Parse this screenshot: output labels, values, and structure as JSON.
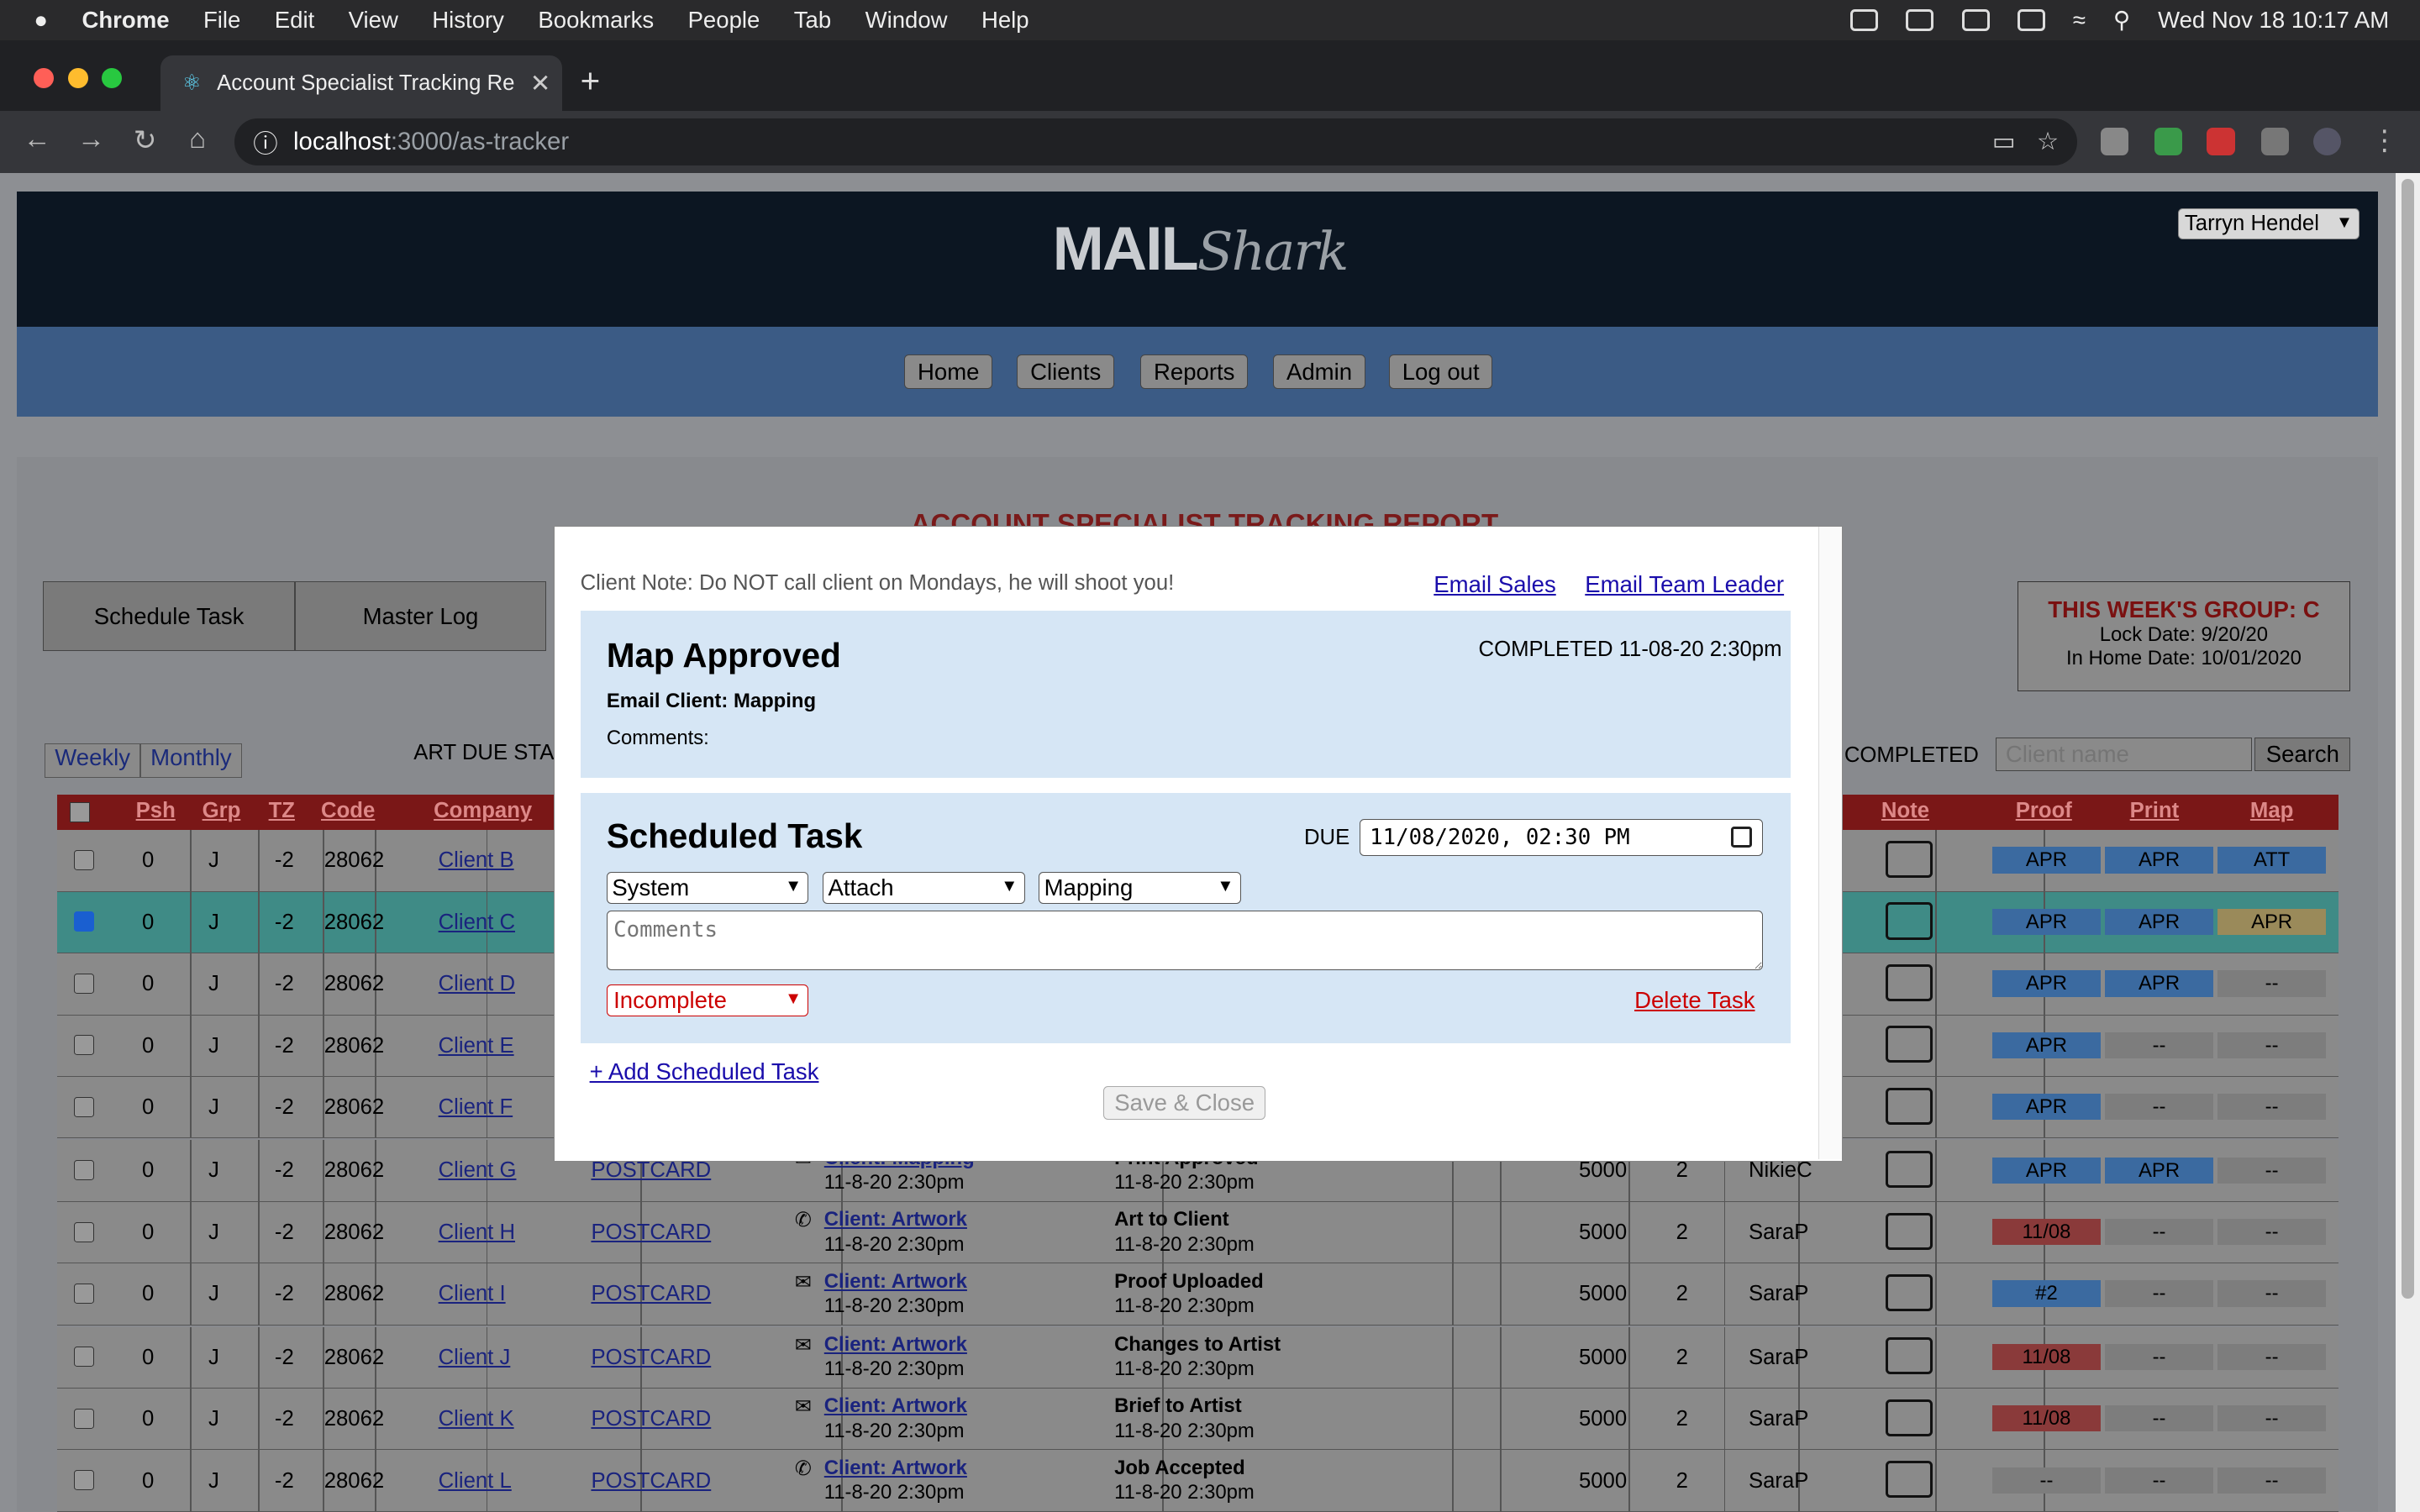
{
  "menubar": {
    "apple": "",
    "app": "Chrome",
    "items": [
      "File",
      "Edit",
      "View",
      "History",
      "Bookmarks",
      "People",
      "Tab",
      "Window",
      "Help"
    ],
    "datetime": "Wed Nov 18  10:17 AM"
  },
  "browser": {
    "tab_title": "Account Specialist Tracking Re",
    "url_host": "localhost",
    "url_path": ":3000/as-tracker"
  },
  "header": {
    "logo_main": "MAIL",
    "logo_script": "Shark",
    "user_select": "Tarryn Hendel"
  },
  "nav": [
    "Home",
    "Clients",
    "Reports",
    "Admin",
    "Log out"
  ],
  "report": {
    "title": "ACCOUNT SPECIALIST TRACKING REPORT",
    "schedule_task_btn": "Schedule Task",
    "master_log_btn": "Master Log",
    "group": {
      "title": "THIS WEEK'S GROUP: C",
      "lock_date": "Lock Date: 9/20/20",
      "in_home_date": "In Home Date: 10/01/2020"
    },
    "view_tabs": [
      "Weekly",
      "Monthly"
    ],
    "art_due_label": "ART DUE STAR",
    "completed_label": "COMPLETED",
    "search_placeholder": "Client name",
    "search_btn": "Search",
    "columns": {
      "psh": "Psh",
      "grp": "Grp",
      "tz": "TZ",
      "code": "Code",
      "company": "Company",
      "note": "Note",
      "proof": "Proof",
      "print": "Print",
      "map": "Map"
    },
    "rows": [
      {
        "psh": "0",
        "grp": "J",
        "tz": "-2",
        "code": "28062",
        "company": "Client B",
        "proof": "APR",
        "print": "APR",
        "map": "ATT"
      },
      {
        "psh": "0",
        "grp": "J",
        "tz": "-2",
        "code": "28062",
        "company": "Client C",
        "proof": "APR",
        "print": "APR",
        "map": "APR"
      },
      {
        "psh": "0",
        "grp": "J",
        "tz": "-2",
        "code": "28062",
        "company": "Client D",
        "proof": "APR",
        "print": "APR",
        "map": "--"
      },
      {
        "psh": "0",
        "grp": "J",
        "tz": "-2",
        "code": "28062",
        "company": "Client E",
        "proof": "APR",
        "print": "--",
        "map": "--"
      },
      {
        "psh": "0",
        "grp": "J",
        "tz": "-2",
        "code": "28062",
        "company": "Client F",
        "proof": "APR",
        "print": "--",
        "map": "--"
      },
      {
        "psh": "0",
        "grp": "J",
        "tz": "-2",
        "code": "28062",
        "company": "Client G",
        "type": "POSTCARD",
        "task": "Client: Mapping",
        "task_time": "11-8-20 2:30pm",
        "status": "Print Approved",
        "status_time": "11-8-20 2:30pm",
        "qty": "5000",
        "n": "2",
        "user": "NikieC",
        "proof": "APR",
        "print": "APR",
        "map": "--"
      },
      {
        "psh": "0",
        "grp": "J",
        "tz": "-2",
        "code": "28062",
        "company": "Client H",
        "type": "POSTCARD",
        "task": "Client: Artwork",
        "task_time": "11-8-20 2:30pm",
        "status": "Art to Client",
        "status_time": "11-8-20 2:30pm",
        "qty": "5000",
        "n": "2",
        "user": "SaraP",
        "proof": "11/08",
        "print": "--",
        "map": "--"
      },
      {
        "psh": "0",
        "grp": "J",
        "tz": "-2",
        "code": "28062",
        "company": "Client I",
        "type": "POSTCARD",
        "task": "Client: Artwork",
        "task_time": "11-8-20 2:30pm",
        "status": "Proof Uploaded",
        "status_time": "11-8-20 2:30pm",
        "qty": "5000",
        "n": "2",
        "user": "SaraP",
        "proof": "#2",
        "print": "--",
        "map": "--"
      },
      {
        "psh": "0",
        "grp": "J",
        "tz": "-2",
        "code": "28062",
        "company": "Client J",
        "type": "POSTCARD",
        "task": "Client: Artwork",
        "task_time": "11-8-20 2:30pm",
        "status": "Changes to Artist",
        "status_time": "11-8-20 2:30pm",
        "qty": "5000",
        "n": "2",
        "user": "SaraP",
        "proof": "11/08",
        "print": "--",
        "map": "--"
      },
      {
        "psh": "0",
        "grp": "J",
        "tz": "-2",
        "code": "28062",
        "company": "Client K",
        "type": "POSTCARD",
        "task": "Client: Artwork",
        "task_time": "11-8-20 2:30pm",
        "status": "Brief to Artist",
        "status_time": "11-8-20 2:30pm",
        "qty": "5000",
        "n": "2",
        "user": "SaraP",
        "proof": "11/08",
        "print": "--",
        "map": "--"
      },
      {
        "psh": "0",
        "grp": "J",
        "tz": "-2",
        "code": "28062",
        "company": "Client L",
        "type": "POSTCARD",
        "task": "Client: Artwork",
        "task_time": "11-8-20 2:30pm",
        "status": "Job Accepted",
        "status_time": "11-8-20 2:30pm",
        "qty": "5000",
        "n": "2",
        "user": "SaraP",
        "proof": "--",
        "print": "--",
        "map": "--"
      }
    ]
  },
  "modal": {
    "client_note": "Client Note: Do NOT call client on Mondays, he will shoot you!",
    "email_sales": "Email Sales",
    "email_team_leader": "Email Team Leader",
    "completed_task": {
      "title": "Map Approved",
      "completed": "COMPLETED 11-08-20 2:30pm",
      "subtitle": "Email Client: Mapping",
      "comments_label": "Comments:"
    },
    "scheduled_task": {
      "title": "Scheduled Task",
      "due_label": "DUE",
      "due_value": "11/08/2020, 02:30 PM",
      "select_1": "System",
      "select_2": "Attach",
      "select_3": "Mapping",
      "comments_placeholder": "Comments",
      "status": "Incomplete",
      "delete_label": "Delete Task"
    },
    "add_task": "+ Add Scheduled Task",
    "save_close": "Save & Close"
  },
  "colors": {
    "header_bg": "#0c1622",
    "nav_bg": "#3b5b85",
    "modal_section_bg": "#d6e6f5",
    "danger": "#cc0000",
    "link": "#1a0dab"
  }
}
